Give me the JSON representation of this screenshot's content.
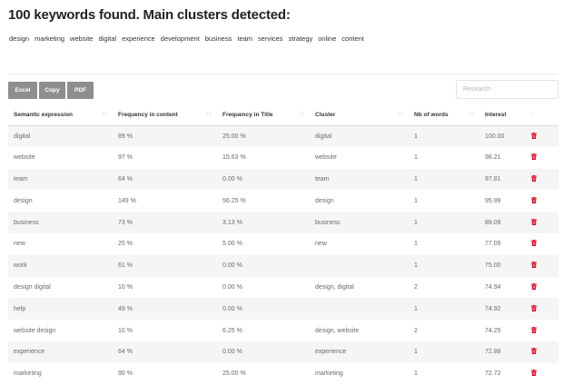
{
  "heading": "100 keywords found. Main clusters detected:",
  "clusters": [
    "design",
    "marketing",
    "website",
    "digital",
    "experience",
    "development",
    "business",
    "team",
    "services",
    "strategy",
    "online",
    "content"
  ],
  "toolbar": {
    "excel_label": "Excel",
    "copy_label": "Copy",
    "pdf_label": "PDF"
  },
  "search": {
    "placeholder": "Research",
    "value": ""
  },
  "colors": {
    "delete_icon": "#e0001b",
    "button_bg": "#8e8e8e",
    "row_stripe": "#f5f5f5"
  },
  "table": {
    "headers": [
      "Semantic expression",
      "Frequency in content",
      "Frequency in Title",
      "Cluster",
      "Nb of words",
      "Interest"
    ],
    "rows": [
      [
        "digital",
        "89 %",
        "25.00 %",
        "digital",
        "1",
        "100.00"
      ],
      [
        "website",
        "97 %",
        "15.63 %",
        "website",
        "1",
        "98.21"
      ],
      [
        "team",
        "64 %",
        "0.00 %",
        "team",
        "1",
        "97.81"
      ],
      [
        "design",
        "149 %",
        "56.25 %",
        "design",
        "1",
        "95.99"
      ],
      [
        "business",
        "73 %",
        "3.13 %",
        "business",
        "1",
        "89.09"
      ],
      [
        "new",
        "25 %",
        "5.00 %",
        "new",
        "1",
        "77.09"
      ],
      [
        "work",
        "61 %",
        "0.00 %",
        "",
        "1",
        "75.00"
      ],
      [
        "design digital",
        "10 %",
        "0.00 %",
        "design, digital",
        "2",
        "74.94"
      ],
      [
        "help",
        "49 %",
        "0.00 %",
        "",
        "1",
        "74.92"
      ],
      [
        "website design",
        "10 %",
        "6.25 %",
        "design, website",
        "2",
        "74.25"
      ],
      [
        "experience",
        "64 %",
        "0.00 %",
        "experience",
        "1",
        "72.88"
      ],
      [
        "marketing",
        "90 %",
        "25.00 %",
        "marketing",
        "1",
        "72.72"
      ]
    ]
  }
}
